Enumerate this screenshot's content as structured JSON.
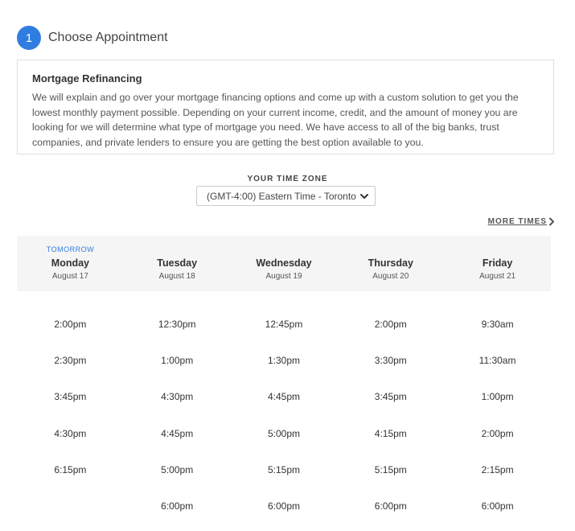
{
  "step": {
    "number": "1",
    "title": "Choose Appointment"
  },
  "service": {
    "title": "Mortgage Refinancing",
    "description": "We will explain and go over your mortgage financing options and come up with a custom solution to get you the lowest monthly payment possible. Depending on your current income, credit, and the amount of money you are looking for we will determine what type of mortgage you need. We have access to all of the big banks, trust companies, and private lenders to ensure you are getting the best option available to you."
  },
  "timezone": {
    "label": "YOUR TIME ZONE",
    "selected": "(GMT-4:00) Eastern Time - Toronto"
  },
  "more_times": {
    "label": "MORE TIMES"
  },
  "days": [
    {
      "tag": "TOMORROW",
      "name": "Monday",
      "date": "August 17",
      "slots": [
        "2:00pm",
        "2:30pm",
        "3:45pm",
        "4:30pm",
        "6:15pm"
      ]
    },
    {
      "tag": "",
      "name": "Tuesday",
      "date": "August 18",
      "slots": [
        "12:30pm",
        "1:00pm",
        "4:30pm",
        "4:45pm",
        "5:00pm",
        "6:00pm"
      ]
    },
    {
      "tag": "",
      "name": "Wednesday",
      "date": "August 19",
      "slots": [
        "12:45pm",
        "1:30pm",
        "4:45pm",
        "5:00pm",
        "5:15pm",
        "6:00pm"
      ]
    },
    {
      "tag": "",
      "name": "Thursday",
      "date": "August 20",
      "slots": [
        "2:00pm",
        "3:30pm",
        "3:45pm",
        "4:15pm",
        "5:15pm",
        "6:00pm"
      ]
    },
    {
      "tag": "",
      "name": "Friday",
      "date": "August 21",
      "slots": [
        "9:30am",
        "11:30am",
        "1:00pm",
        "2:00pm",
        "2:15pm",
        "6:00pm"
      ]
    }
  ],
  "colors": {
    "accent": "#2f7de1",
    "header_bg": "#f5f5f5",
    "border": "#dedede"
  }
}
